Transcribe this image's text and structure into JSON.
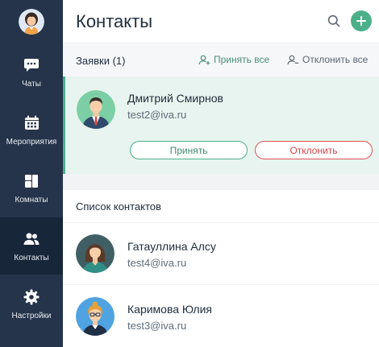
{
  "sidebar": {
    "items": [
      {
        "label": "Чаты",
        "icon": "chat-icon"
      },
      {
        "label": "Мероприятия",
        "icon": "calendar-icon"
      },
      {
        "label": "Комнаты",
        "icon": "rooms-icon"
      },
      {
        "label": "Контакты",
        "icon": "contacts-icon",
        "active": true
      },
      {
        "label": "Настройки",
        "icon": "gear-icon"
      }
    ]
  },
  "header": {
    "title": "Контакты",
    "accent_color": "#4bb08a"
  },
  "requests": {
    "title": "Заявки (1)",
    "accept_all": "Принять все",
    "reject_all": "Отклонить все",
    "items": [
      {
        "name": "Дмитрий Смирнов",
        "email": "test2@iva.ru",
        "accept": "Принять",
        "reject": "Отклонить"
      }
    ]
  },
  "contacts": {
    "title": "Список контактов",
    "items": [
      {
        "name": "Гатауллина Алсу",
        "email": "test4@iva.ru"
      },
      {
        "name": "Каримова Юлия",
        "email": "test3@iva.ru"
      }
    ]
  }
}
